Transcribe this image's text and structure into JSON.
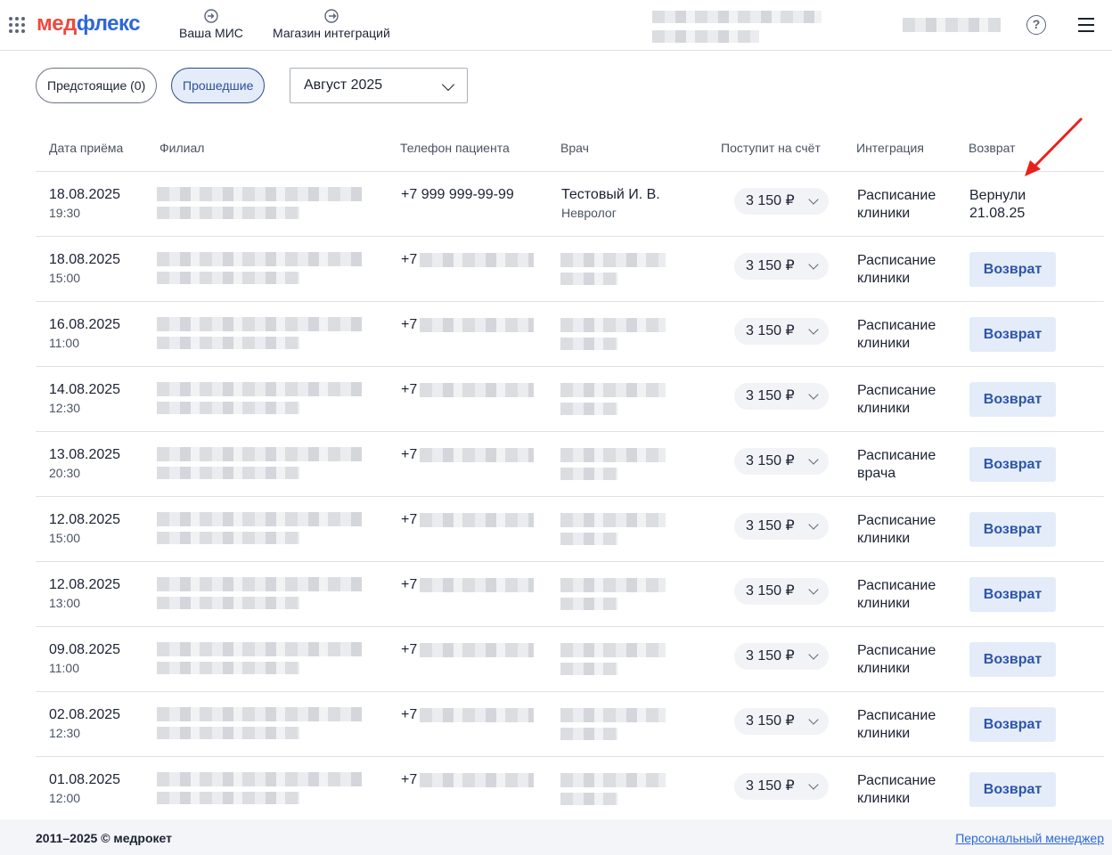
{
  "brand": {
    "part1": "мед",
    "part2": "флекс"
  },
  "nav": [
    {
      "label": "Ваша МИС"
    },
    {
      "label": "Магазин интеграций"
    }
  ],
  "filters": {
    "upcoming": "Предстоящие (0)",
    "past": "Прошедшие",
    "month": "Август 2025"
  },
  "columns": {
    "date": "Дата приёма",
    "branch": "Филиал",
    "phone": "Телефон пациента",
    "doctor": "Врач",
    "amount": "Поступит на счёт",
    "integration": "Интеграция",
    "refund": "Возврат"
  },
  "rows": [
    {
      "date": "18.08.2025",
      "time": "19:30",
      "phone": "+7 999 999-99-99",
      "doctor": "Тестовый И. В.",
      "spec": "Невролог",
      "amount": "3 150 ₽",
      "integration": "Расписание клиники",
      "refund_status": "Вернули 21.08.25"
    },
    {
      "date": "18.08.2025",
      "time": "15:00",
      "phone": "+7",
      "amount": "3 150 ₽",
      "integration": "Расписание клиники",
      "refund_btn": "Возврат"
    },
    {
      "date": "16.08.2025",
      "time": "11:00",
      "phone": "+7",
      "amount": "3 150 ₽",
      "integration": "Расписание клиники",
      "refund_btn": "Возврат"
    },
    {
      "date": "14.08.2025",
      "time": "12:30",
      "phone": "+7",
      "amount": "3 150 ₽",
      "integration": "Расписание клиники",
      "refund_btn": "Возврат"
    },
    {
      "date": "13.08.2025",
      "time": "20:30",
      "phone": "+7",
      "amount": "3 150 ₽",
      "integration": "Расписание врача",
      "refund_btn": "Возврат"
    },
    {
      "date": "12.08.2025",
      "time": "15:00",
      "phone": "+7",
      "amount": "3 150 ₽",
      "integration": "Расписание клиники",
      "refund_btn": "Возврат"
    },
    {
      "date": "12.08.2025",
      "time": "13:00",
      "phone": "+7",
      "amount": "3 150 ₽",
      "integration": "Расписание клиники",
      "refund_btn": "Возврат"
    },
    {
      "date": "09.08.2025",
      "time": "11:00",
      "phone": "+7",
      "amount": "3 150 ₽",
      "integration": "Расписание клиники",
      "refund_btn": "Возврат"
    },
    {
      "date": "02.08.2025",
      "time": "12:30",
      "phone": "+7",
      "amount": "3 150 ₽",
      "integration": "Расписание клиники",
      "refund_btn": "Возврат"
    },
    {
      "date": "01.08.2025",
      "time": "12:00",
      "phone": "+7",
      "amount": "3 150 ₽",
      "integration": "Расписание клиники",
      "refund_btn": "Возврат"
    }
  ],
  "footer": {
    "copyright": "2011–2025 © медрокет",
    "manager": "Персональный менеджер"
  },
  "colors": {
    "accent": "#2d67d8",
    "brand_red": "#f0483e",
    "arrow": "#e8221b"
  }
}
